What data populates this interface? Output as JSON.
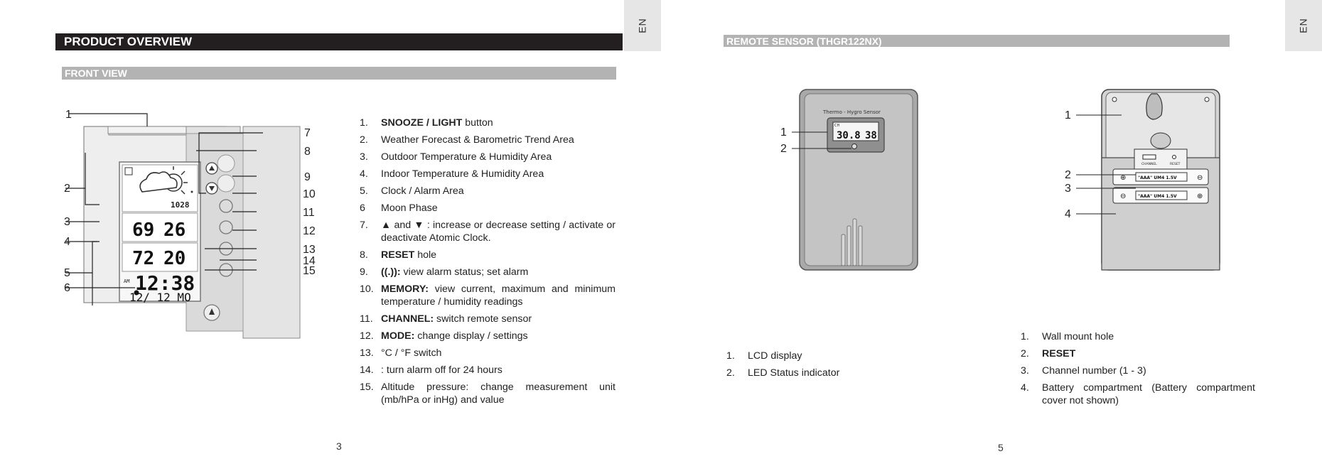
{
  "left_page": {
    "lang_tab": "EN",
    "header": "PRODUCT OVERVIEW",
    "section": "FRONT VIEW",
    "callouts": [
      "1",
      "2",
      "3",
      "4",
      "5",
      "6",
      "7",
      "8",
      "9",
      "10",
      "11",
      "12",
      "13",
      "14",
      "15"
    ],
    "lcd": {
      "pressure": "1028",
      "outdoor_humidity": "69",
      "outdoor_temp": "26",
      "indoor_humidity": "72",
      "indoor_temp": "20",
      "am": "AM",
      "time": "12:38",
      "date": "12/ 12 MO"
    },
    "items": [
      {
        "num": "1.",
        "bold": "SNOOZE / LIGHT",
        "text": " button"
      },
      {
        "num": "2.",
        "bold": "",
        "text": "Weather Forecast & Barometric Trend Area"
      },
      {
        "num": "3.",
        "bold": "",
        "text": "Outdoor Temperature & Humidity Area"
      },
      {
        "num": "4.",
        "bold": "",
        "text": "Indoor Temperature & Humidity Area"
      },
      {
        "num": "5.",
        "bold": "",
        "text": "Clock / Alarm Area"
      },
      {
        "num": "6",
        "bold": "",
        "text": "Moon Phase"
      },
      {
        "num": "7.",
        "bold": "",
        "text": "▲ and ▼ :  increase or decrease setting / activate or deactivate Atomic Clock."
      },
      {
        "num": "8.",
        "bold": "RESET",
        "text": " hole"
      },
      {
        "num": "9.",
        "bold": "((.)):",
        "text": " view alarm status; set alarm"
      },
      {
        "num": "10.",
        "bold": "MEMORY:",
        "text": " view current, maximum and minimum temperature / humidity readings"
      },
      {
        "num": "11.",
        "bold": "CHANNEL:",
        "text": " switch remote sensor"
      },
      {
        "num": "12.",
        "bold": "MODE:",
        "text": " change display / settings"
      },
      {
        "num": "13.",
        "bold": "",
        "text": "°C / °F switch"
      },
      {
        "num": "14.",
        "bold": "",
        "text": " : turn alarm off for 24 hours"
      },
      {
        "num": "15.",
        "bold": "",
        "text": "Altitude pressure:  change measurement unit (mb/hPa or inHg)  and value"
      }
    ],
    "page_number": "3"
  },
  "right_page": {
    "lang_tab": "EN",
    "header": "REMOTE SENSOR (THGR122NX)",
    "sensor_label": "Thermo - Hygro Sensor",
    "sensor_lcd": {
      "ch": "CH",
      "temp": "30.8",
      "hum": "38"
    },
    "front_callouts": [
      "1",
      "2"
    ],
    "back_callouts": [
      "1",
      "2",
      "3",
      "4"
    ],
    "battery_label": "\"AAA\" UM4 1.5V",
    "channel_label": "CHANNEL",
    "reset_label": "RESET",
    "front_items": [
      {
        "num": "1.",
        "text": "LCD display"
      },
      {
        "num": "2.",
        "text": "LED Status indicator"
      }
    ],
    "back_items": [
      {
        "num": "1.",
        "bold": "",
        "text": "Wall mount hole"
      },
      {
        "num": "2.",
        "bold": "RESET",
        "text": ""
      },
      {
        "num": "3.",
        "bold": "",
        "text": "Channel number (1 - 3)"
      },
      {
        "num": "4.",
        "bold": "",
        "text": "Battery compartment (Battery compartment cover not shown)"
      }
    ],
    "page_number": "5"
  },
  "colors": {
    "dark_bar": "#231f20",
    "grey_bar": "#b3b3b3",
    "tab": "#e6e6e6"
  }
}
